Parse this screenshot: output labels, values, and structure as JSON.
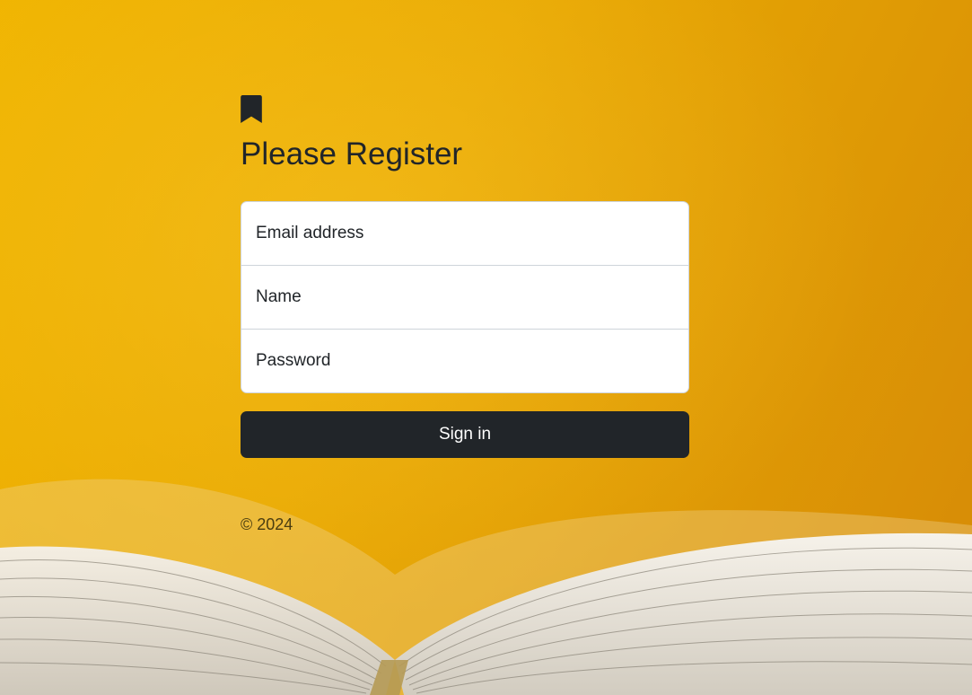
{
  "form": {
    "title": "Please Register",
    "fields": [
      {
        "label": "Email address"
      },
      {
        "label": "Name"
      },
      {
        "label": "Password"
      }
    ],
    "submit_label": "Sign in"
  },
  "footer": {
    "copyright": "© 2024"
  },
  "icons": {
    "logo": "bookmark-icon"
  },
  "colors": {
    "background": "#e9a903",
    "button": "#212529",
    "text": "#212529"
  }
}
